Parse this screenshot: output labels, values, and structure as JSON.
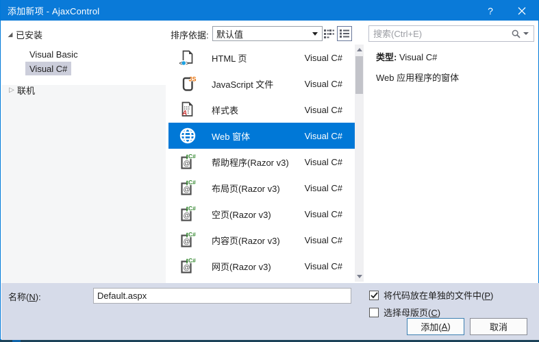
{
  "window": {
    "title": "添加新项 - AjaxControl",
    "help_glyph": "?"
  },
  "sidebar": {
    "installed_label": "已安装",
    "expanded_glyph": "◢",
    "collapsed_glyph": "▷",
    "items": [
      {
        "label": "Visual Basic",
        "selected": false
      },
      {
        "label": "Visual C#",
        "selected": true
      }
    ],
    "online_label": "联机"
  },
  "toolbar": {
    "sort_label": "排序依据:",
    "sort_value": "默认值",
    "view_icons": [
      "small-icons-view",
      "list-view-selected"
    ]
  },
  "search": {
    "placeholder": "搜索(Ctrl+E)"
  },
  "list": {
    "items": [
      {
        "icon": "html",
        "name": "HTML 页",
        "lang": "Visual C#",
        "selected": false
      },
      {
        "icon": "js",
        "name": "JavaScript 文件",
        "lang": "Visual C#",
        "selected": false
      },
      {
        "icon": "css",
        "name": "样式表",
        "lang": "Visual C#",
        "selected": false
      },
      {
        "icon": "webform",
        "name": "Web 窗体",
        "lang": "Visual C#",
        "selected": true
      },
      {
        "icon": "razor",
        "name": "帮助程序(Razor v3)",
        "lang": "Visual C#",
        "selected": false
      },
      {
        "icon": "razor",
        "name": "布局页(Razor v3)",
        "lang": "Visual C#",
        "selected": false
      },
      {
        "icon": "razor",
        "name": "空页(Razor v3)",
        "lang": "Visual C#",
        "selected": false
      },
      {
        "icon": "razor",
        "name": "内容页(Razor v3)",
        "lang": "Visual C#",
        "selected": false
      },
      {
        "icon": "razor",
        "name": "网页(Razor v3)",
        "lang": "Visual C#",
        "selected": false
      }
    ]
  },
  "details": {
    "type_label": "类型:",
    "type_value": "Visual C#",
    "description": "Web 应用程序的窗体"
  },
  "footer": {
    "name_label_pre": "名称(",
    "name_label_key": "N",
    "name_label_post": "):",
    "name_value": "Default.aspx",
    "checkbox_code_pre": "将代码放在单独的文件中(",
    "checkbox_code_key": "P",
    "checkbox_code_post": ")",
    "checkbox_code_checked": true,
    "checkbox_master_pre": "选择母版页(",
    "checkbox_master_key": "C",
    "checkbox_master_post": ")",
    "checkbox_master_checked": false,
    "add_pre": "添加(",
    "add_key": "A",
    "add_post": ")",
    "cancel_label": "取消"
  },
  "colors": {
    "titlebar_blue": "#0a7ad8",
    "selection_blue": "#0078d7",
    "footer_bg": "#d6dbe9",
    "sidebar_selection": "#cccedb"
  }
}
